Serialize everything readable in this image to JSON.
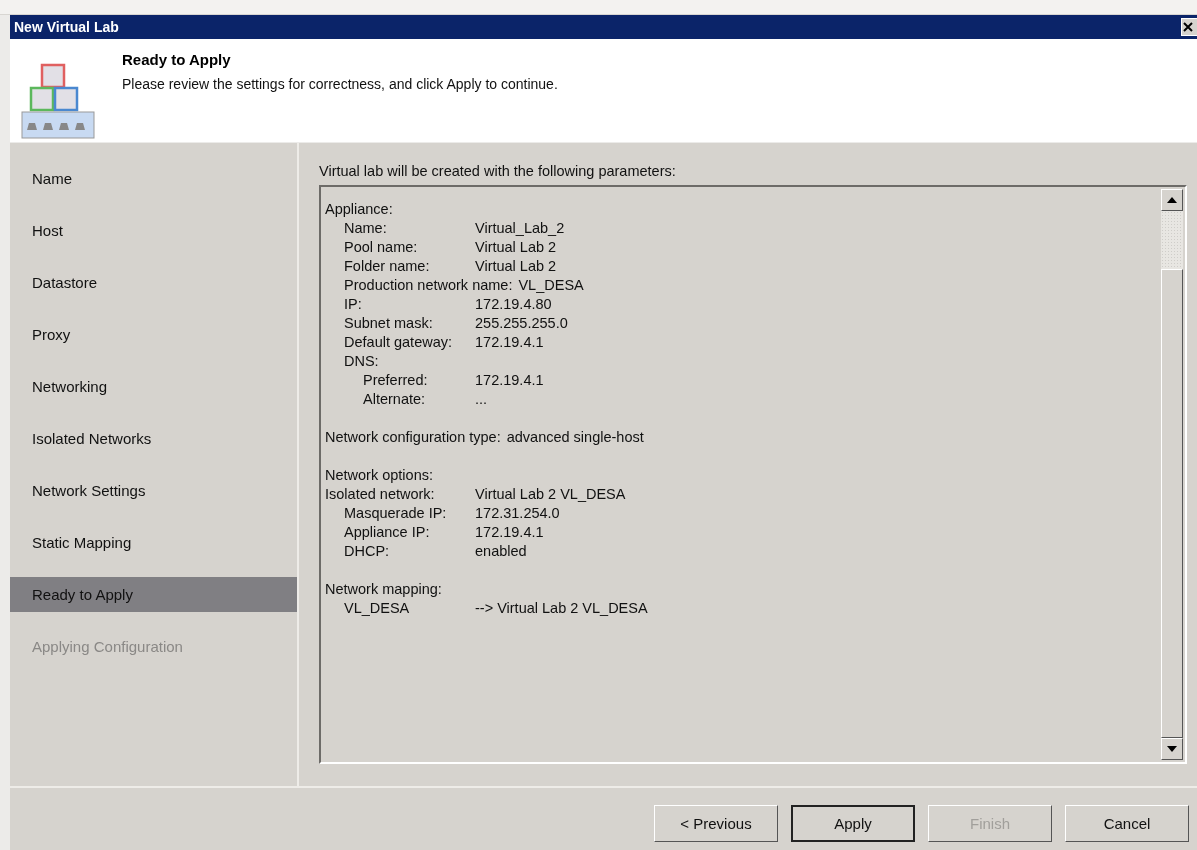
{
  "window": {
    "title": "New Virtual Lab"
  },
  "header": {
    "title": "Ready to Apply",
    "subtitle": "Please review the settings for correctness, and click Apply to continue."
  },
  "steps": [
    {
      "label": "Name",
      "selected": false,
      "disabled": false
    },
    {
      "label": "Host",
      "selected": false,
      "disabled": false
    },
    {
      "label": "Datastore",
      "selected": false,
      "disabled": false
    },
    {
      "label": "Proxy",
      "selected": false,
      "disabled": false
    },
    {
      "label": "Networking",
      "selected": false,
      "disabled": false
    },
    {
      "label": "Isolated Networks",
      "selected": false,
      "disabled": false
    },
    {
      "label": "Network Settings",
      "selected": false,
      "disabled": false
    },
    {
      "label": "Static Mapping",
      "selected": false,
      "disabled": false
    },
    {
      "label": "Ready to Apply",
      "selected": true,
      "disabled": false
    },
    {
      "label": "Applying Configuration",
      "selected": false,
      "disabled": true
    }
  ],
  "summary": {
    "caption": "Virtual lab will be created with the following parameters:",
    "groups": [
      {
        "lines": [
          {
            "label": "Appliance:",
            "children": [
              {
                "label": "Name:",
                "value": "Virtual_Lab_2"
              },
              {
                "label": "Pool name:",
                "value": "Virtual Lab 2"
              },
              {
                "label": "Folder name:",
                "value": "Virtual Lab 2"
              },
              {
                "label": "Production network name:",
                "value": "VL_DESA"
              },
              {
                "label": "IP:",
                "value": "172.19.4.80"
              },
              {
                "label": "Subnet mask:",
                "value": "255.255.255.0"
              },
              {
                "label": "Default gateway:",
                "value": "172.19.4.1"
              },
              {
                "label": "DNS:",
                "children": [
                  {
                    "label": "Preferred:",
                    "value": "172.19.4.1"
                  },
                  {
                    "label": "Alternate:",
                    "value": "..."
                  }
                ]
              }
            ]
          }
        ]
      },
      {
        "lines": [
          {
            "label": "Network configuration type:",
            "value": "advanced single-host"
          }
        ]
      },
      {
        "lines": [
          {
            "label": "Network options:"
          },
          {
            "label": "Isolated network:",
            "value": "Virtual Lab 2 VL_DESA",
            "children": [
              {
                "label": "Masquerade IP:",
                "value": "172.31.254.0"
              },
              {
                "label": "Appliance IP:",
                "value": "172.19.4.1"
              },
              {
                "label": "DHCP:",
                "value": "enabled"
              }
            ]
          }
        ]
      },
      {
        "lines": [
          {
            "label": "Network mapping:",
            "children": [
              {
                "label": "VL_DESA",
                "value": "--> Virtual Lab 2 VL_DESA"
              }
            ]
          }
        ]
      }
    ]
  },
  "buttons": [
    {
      "label": "< Previous",
      "default": false,
      "disabled": false
    },
    {
      "label": "Apply",
      "default": true,
      "disabled": false
    },
    {
      "label": "Finish",
      "default": false,
      "disabled": true
    },
    {
      "label": "Cancel",
      "default": false,
      "disabled": false
    }
  ]
}
